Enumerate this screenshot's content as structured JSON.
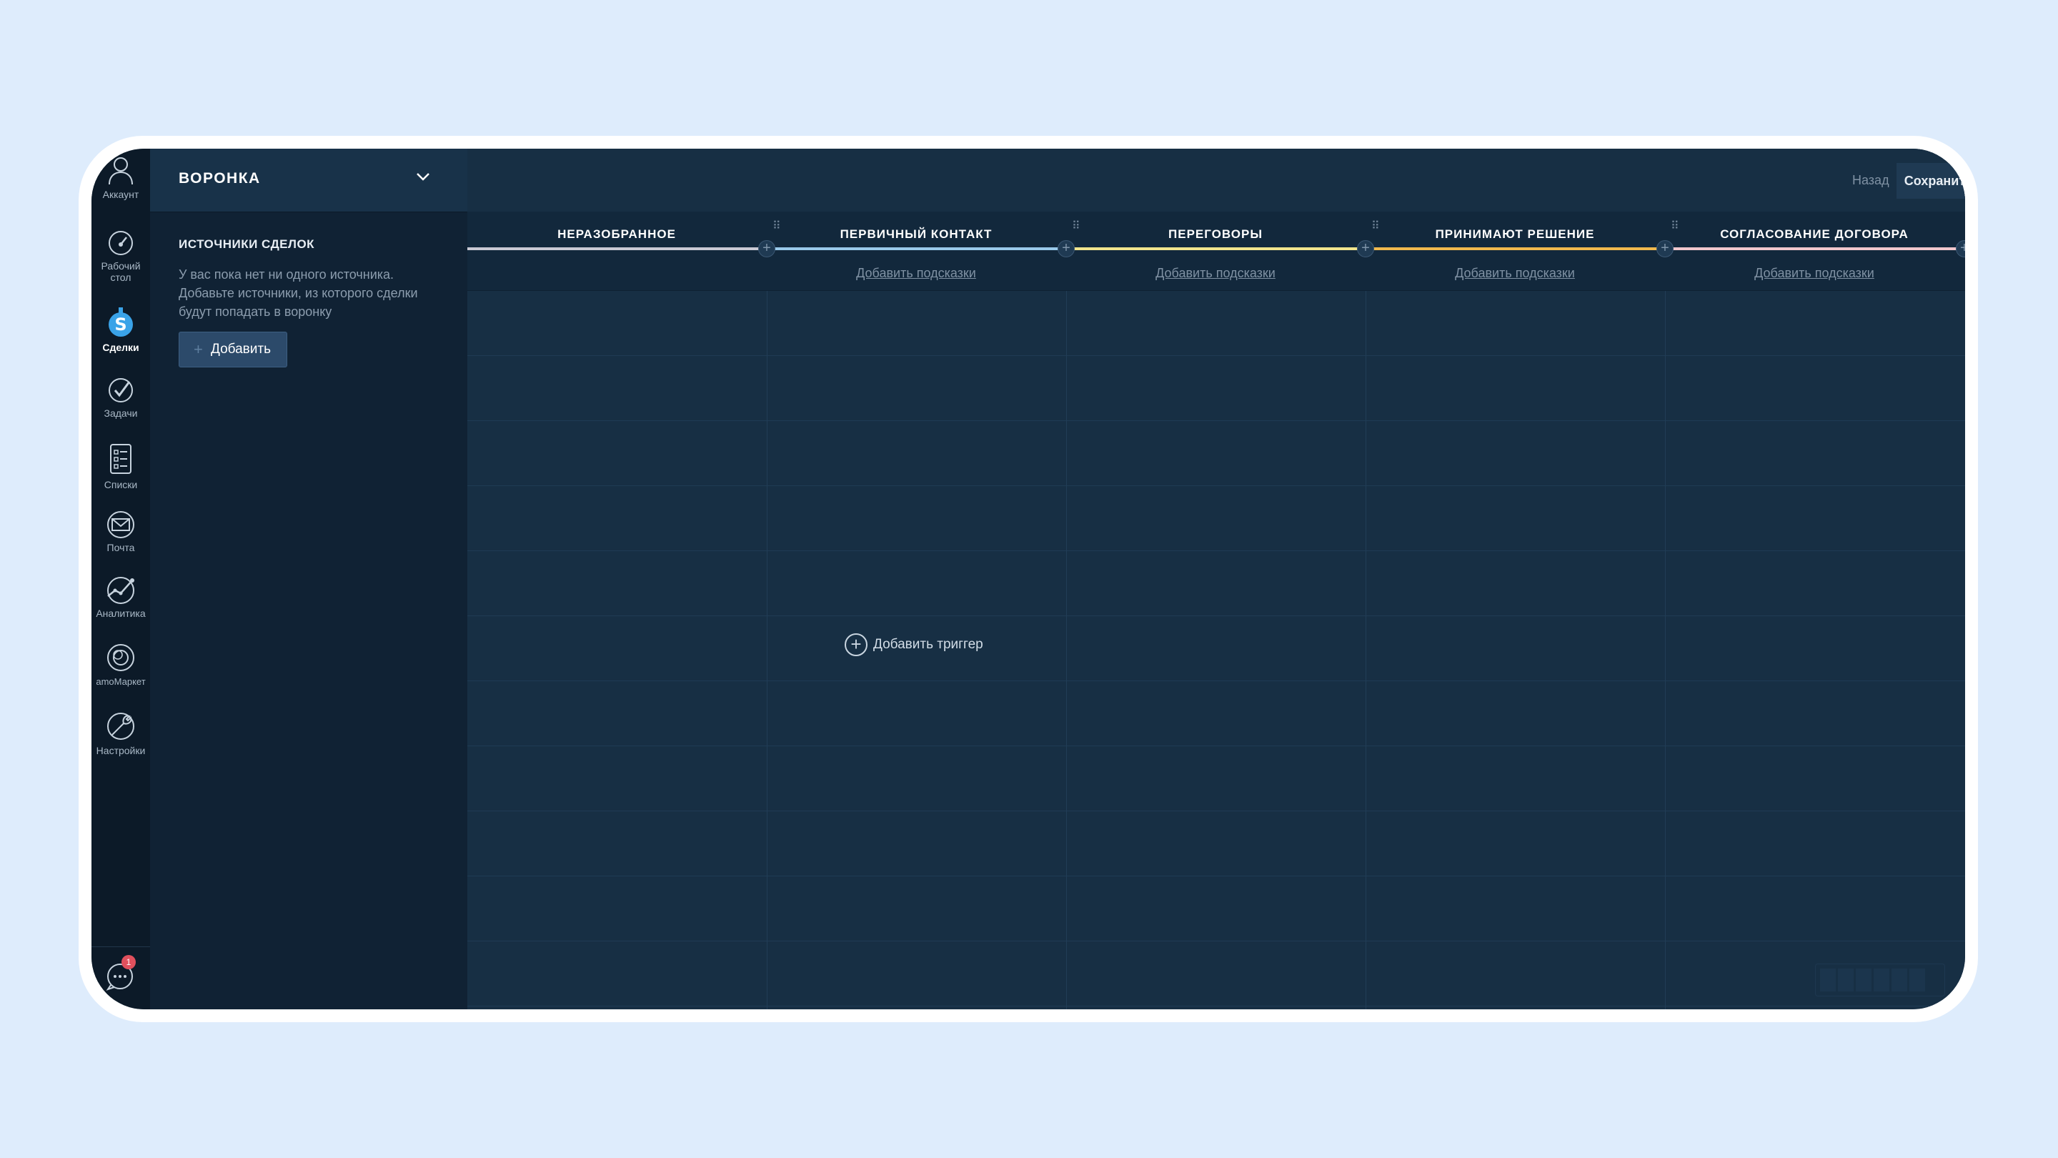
{
  "nav": {
    "items": [
      {
        "label": "Аккаунт",
        "icon": "avatar-icon"
      },
      {
        "label": "Рабочий стол",
        "icon": "dashboard-icon"
      },
      {
        "label": "Сделки",
        "icon": "deals-icon",
        "active": true
      },
      {
        "label": "Задачи",
        "icon": "tasks-icon"
      },
      {
        "label": "Списки",
        "icon": "lists-icon"
      },
      {
        "label": "Почта",
        "icon": "mail-icon"
      },
      {
        "label": "Аналитика",
        "icon": "analytics-icon"
      },
      {
        "label": "amoМаркет",
        "icon": "market-icon"
      },
      {
        "label": "Настройки",
        "icon": "settings-icon"
      }
    ],
    "chat_badge": "1"
  },
  "sidebar": {
    "title": "ВОРОНКА",
    "sources_title": "ИСТОЧНИКИ СДЕЛОК",
    "sources_text": "У вас пока нет ни одного источника. Добавьте источники, из которого сделки будут попадать в воронку",
    "add_label": "Добавить"
  },
  "topbar": {
    "back_label": "Назад",
    "save_label": "Сохранить"
  },
  "stages": [
    {
      "name": "НЕРАЗОБРАННОЕ",
      "color": "#c9c9d4",
      "hint": ""
    },
    {
      "name": "ПЕРВИЧНЫЙ КОНТАКТ",
      "color": "#99c9ea",
      "hint": "Добавить подсказки"
    },
    {
      "name": "ПЕРЕГОВОРЫ",
      "color": "#f1e48d",
      "hint": "Добавить подсказки"
    },
    {
      "name": "ПРИНИМАЮТ РЕШЕНИЕ",
      "color": "#f0b94d",
      "hint": "Добавить подсказки"
    },
    {
      "name": "СОГЛАСОВАНИЕ ДОГОВОРА",
      "color": "#f1c7cd",
      "hint": "Добавить подсказки"
    }
  ],
  "trigger_label": "Добавить триггер",
  "colors": {
    "background": "#172f44",
    "nav": "#0c1a28",
    "sidebar": "#102234",
    "accent_button": "#2c4a6a"
  }
}
